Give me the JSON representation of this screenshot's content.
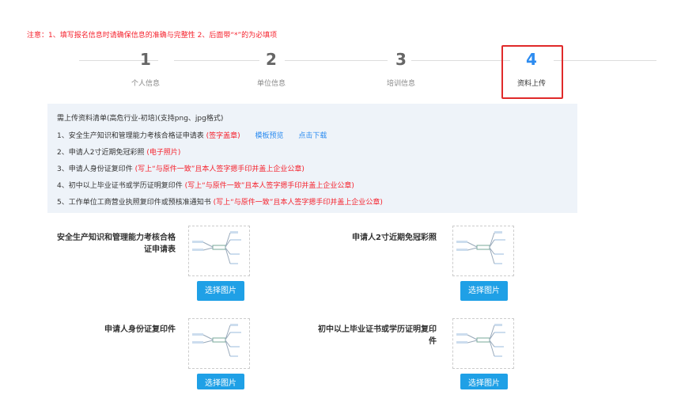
{
  "notice": "注意：1、填写报名信息时请确保信息的准确与完整性 2、后面带“*”的为必填项",
  "steps": [
    {
      "num": "1",
      "label": "个人信息"
    },
    {
      "num": "2",
      "label": "单位信息"
    },
    {
      "num": "3",
      "label": "培训信息"
    },
    {
      "num": "4",
      "label": "资料上传"
    }
  ],
  "requirements": {
    "title": "需上传资料清单(高危行业-初培)(支持png、jpg格式)",
    "items": [
      {
        "text": "1、安全生产知识和管理能力考核合格证申请表 ",
        "note": "(签字盖章)",
        "links": [
          "模板预览",
          "点击下载"
        ]
      },
      {
        "text": "2、申请人2寸近期免冠彩照 ",
        "note": "(电子照片)"
      },
      {
        "text": "3、申请人身份证复印件 ",
        "note": "(写上“与原件一致”且本人签字摁手印并盖上企业公章)"
      },
      {
        "text": "4、初中以上毕业证书或学历证明复印件 ",
        "note": "(写上“与原件一致”且本人签字摁手印并盖上企业公章)"
      },
      {
        "text": "5、工作单位工商营业执照复印件或预核准通知书 ",
        "note": "(写上“与原件一致”且本人签字摁手印并盖上企业公章)"
      }
    ]
  },
  "uploads": [
    {
      "label": "安全生产知识和管理能力考核合格证申请表",
      "button": "选择图片"
    },
    {
      "label": "申请人2寸近期免冠彩照",
      "button": "选择图片"
    },
    {
      "label": "申请人身份证复印件",
      "button": "选择图片"
    },
    {
      "label": "初中以上毕业证书或学历证明复印件",
      "button": "选择图片"
    }
  ],
  "colors": {
    "accent": "#2d8cf0",
    "warning": "#f5222d",
    "button": "#1fa0e6"
  }
}
